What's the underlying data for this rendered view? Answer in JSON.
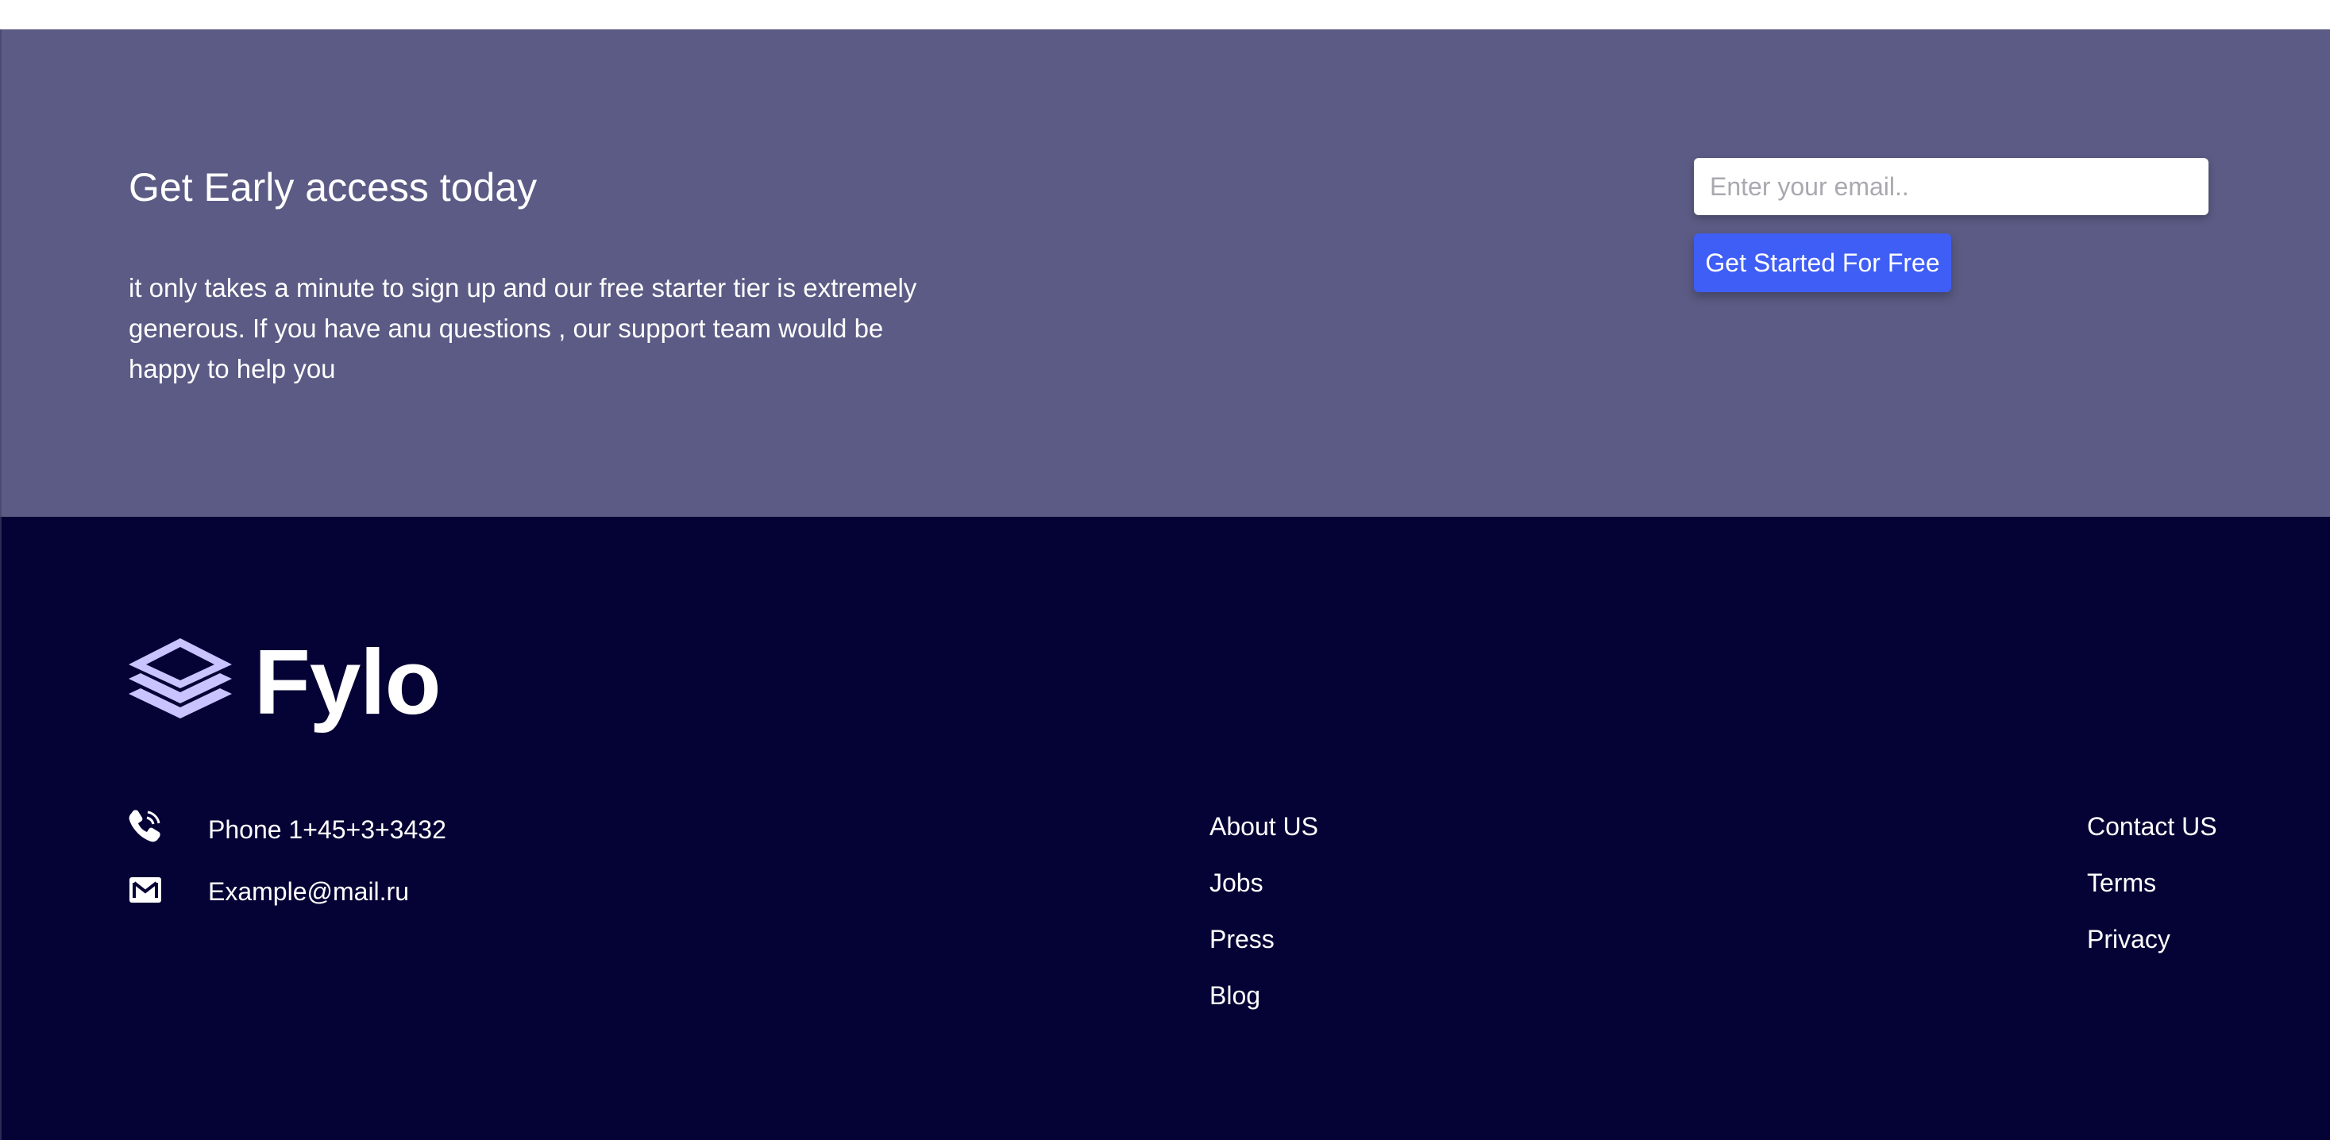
{
  "cta": {
    "title": "Get Early access today",
    "text": "it only takes a minute to sign up and our free starter tier is extremely generous. If you have anu questions , our support team would be happy to help you",
    "email_placeholder": "Enter your email..",
    "button_label": "Get Started For Free",
    "background_color": "#5b5b85",
    "button_color": "#3f5ef5"
  },
  "footer": {
    "background_color": "#050335",
    "logo": {
      "text": "Fylo",
      "icon": "layers-icon",
      "icon_color": "#c9c4ff"
    },
    "contact": {
      "phone": {
        "icon": "phone-icon",
        "text": "Phone 1+45+3+3432"
      },
      "email": {
        "icon": "mail-icon",
        "text": "Example@mail.ru"
      }
    },
    "links_col1": [
      "About US",
      "Jobs",
      "Press",
      "Blog"
    ],
    "links_col2": [
      "Contact US",
      "Terms",
      "Privacy"
    ]
  }
}
